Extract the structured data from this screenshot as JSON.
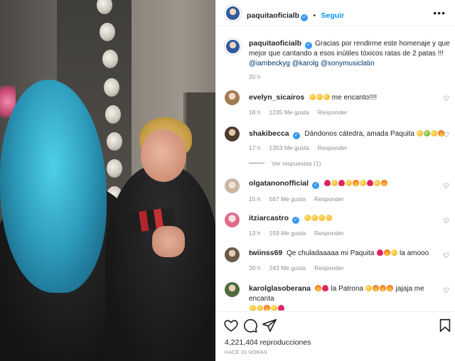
{
  "post": {
    "username": "paquitaoficialb",
    "follow_label": "Seguir",
    "more_label": "•••",
    "caption": "Gracias por rendirme este homenaje y que mejor que cantando a esos inútiles tóxicos ratas de 2 patas !!!",
    "mentions": [
      "@iambeckyg",
      "@karolg",
      "@sonymusiclatin"
    ],
    "caption_time": "20 h",
    "views": "4,221,404 reproducciones",
    "time_ago": "HACE 20 HORAS"
  },
  "comments": [
    {
      "username": "evelyn_sicairos",
      "verified": false,
      "text": "me encanto!!!!",
      "time": "18 h",
      "likes": "1235 Me gusta",
      "reply": "Responder"
    },
    {
      "username": "shakibecca",
      "verified": true,
      "text": "Dándonos cátedra, amada Paquita",
      "time": "17 h",
      "likes": "1353 Me gusta",
      "reply": "Responder",
      "replies_label": "Ver respuestas (1)"
    },
    {
      "username": "olgatanonofficial",
      "verified": true,
      "text": "",
      "time": "15 h",
      "likes": "567 Me gusta",
      "reply": "Responder"
    },
    {
      "username": "itziarcastro",
      "verified": true,
      "text": "",
      "time": "13 h",
      "likes": "159 Me gusta",
      "reply": "Responder"
    },
    {
      "username": "twiinss69",
      "verified": false,
      "text": "Qe chuladaaaaa mi Paquita",
      "text2": "la amooo",
      "time": "20 h",
      "likes": "243 Me gusta",
      "reply": "Responder"
    },
    {
      "username": "karolglasoberana",
      "verified": false,
      "text": "la Patrona",
      "text2": "jajaja me encanta",
      "time": "",
      "likes": "",
      "reply": ""
    }
  ],
  "icons": {
    "heart": "heart-icon",
    "comment": "comment-icon",
    "share": "share-icon",
    "save": "bookmark-icon",
    "verified": "verified-badge-icon",
    "small_heart": "small-heart-icon"
  },
  "colors": {
    "link": "#0095f6",
    "mention": "#00376b",
    "verified": "#3897f0",
    "muted": "#8e8e8e"
  }
}
